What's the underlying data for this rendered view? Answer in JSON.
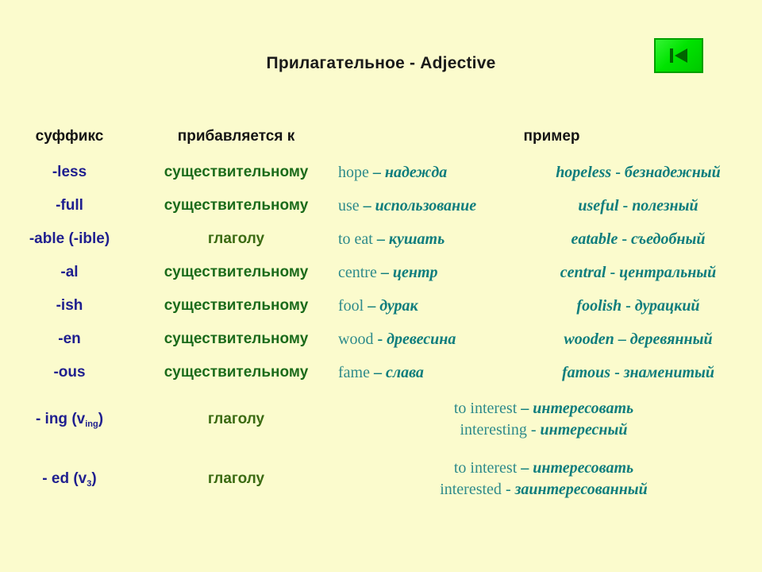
{
  "slide": {
    "title": "Прилагательное - Adjective",
    "background_color": "#fbfbcd"
  },
  "nav": {
    "button_name": "previous-slide",
    "icon": "skip-back-icon",
    "color": "#00e400"
  },
  "table": {
    "headers": {
      "suffix": "суффикс",
      "attaches_to": "прибавляется к",
      "example": "пример"
    },
    "rows": [
      {
        "suffix": "-less",
        "suffix_sub": "",
        "attaches_to": "существительному",
        "attach_type": "noun",
        "base_en": "hope",
        "base_sep": "–",
        "base_ru": "надежда",
        "derived_en": "hopeless",
        "derived_sep": "-",
        "derived_ru": "безнадежный"
      },
      {
        "suffix": "-full",
        "suffix_sub": "",
        "attaches_to": "существительному",
        "attach_type": "noun",
        "base_en": "use",
        "base_sep": "–",
        "base_ru": "использование",
        "derived_en": "useful",
        "derived_sep": "-",
        "derived_ru": "полезный"
      },
      {
        "suffix": "-able (-ible)",
        "suffix_sub": "",
        "attaches_to": "глаголу",
        "attach_type": "verb",
        "base_en": "to eat",
        "base_sep": "–",
        "base_ru": "кушать",
        "derived_en": "eatable",
        "derived_sep": "-",
        "derived_ru": "съедобный"
      },
      {
        "suffix": "-al",
        "suffix_sub": "",
        "attaches_to": "существительному",
        "attach_type": "noun",
        "base_en": "centre",
        "base_sep": "–",
        "base_ru": "центр",
        "derived_en": "central",
        "derived_sep": "-",
        "derived_ru": "центральный"
      },
      {
        "suffix": "-ish",
        "suffix_sub": "",
        "attaches_to": "существительному",
        "attach_type": "noun",
        "base_en": "fool",
        "base_sep": "–",
        "base_ru": "дурак",
        "derived_en": "foolish",
        "derived_sep": "-",
        "derived_ru": "дурацкий"
      },
      {
        "suffix": "-en",
        "suffix_sub": "",
        "attaches_to": "существительному",
        "attach_type": "noun",
        "base_en": "wood",
        "base_sep": "-",
        "base_ru": "древесина",
        "derived_en": "wooden",
        "derived_sep": "–",
        "derived_ru": "деревянный"
      },
      {
        "suffix": "-ous",
        "suffix_sub": "",
        "attaches_to": "существительному",
        "attach_type": "noun",
        "base_en": "fame",
        "base_sep": "–",
        "base_ru": "слава",
        "derived_en": "famous",
        "derived_sep": "-",
        "derived_ru": "знаменитый"
      }
    ],
    "stacked_rows": [
      {
        "suffix_prefix": "- ing (v",
        "suffix_sub": "ing",
        "suffix_suffix": ")",
        "attaches_to": "глаголу",
        "attach_type": "verb",
        "line1_en": "to interest",
        "line1_sep": "–",
        "line1_ru": "интересовать",
        "line2_en": "interesting",
        "line2_sep": "-",
        "line2_ru": "интересный"
      },
      {
        "suffix_prefix": "- ed (v",
        "suffix_sub": "3",
        "suffix_suffix": ")",
        "attaches_to": "глаголу",
        "attach_type": "verb",
        "line1_en": "to interest",
        "line1_sep": "–",
        "line1_ru": "интересовать",
        "line2_en": "interested",
        "line2_sep": "-",
        "line2_ru": "заинтересованный"
      }
    ]
  }
}
